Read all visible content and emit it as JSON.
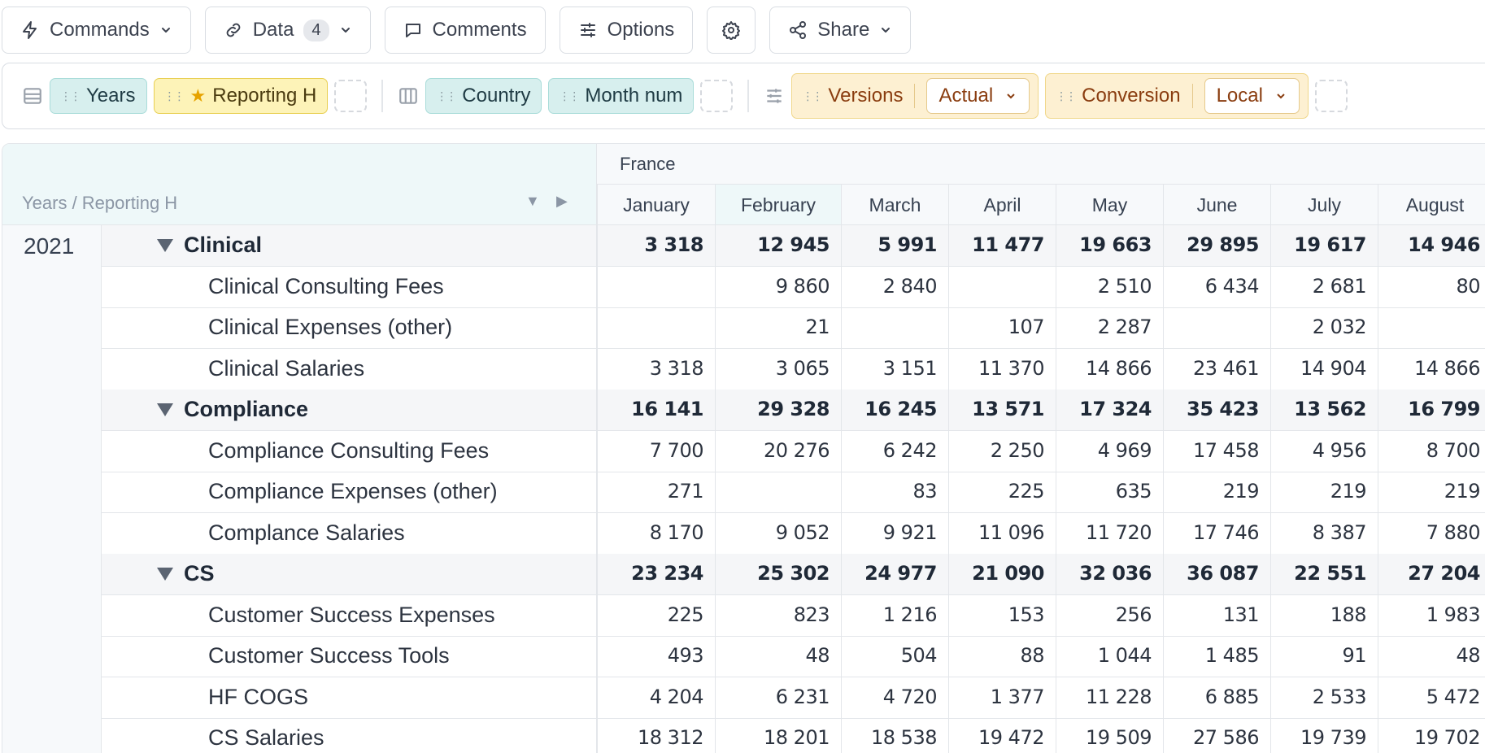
{
  "toolbar": {
    "commands": "Commands",
    "data": "Data",
    "data_count": "4",
    "comments": "Comments",
    "options": "Options",
    "share": "Share"
  },
  "pivot": {
    "rows": [
      "Years",
      "Reporting H"
    ],
    "columns": [
      "Country",
      "Month num"
    ],
    "filters": [
      {
        "name": "Versions",
        "value": "Actual"
      },
      {
        "name": "Conversion",
        "value": "Local"
      }
    ]
  },
  "grid": {
    "corner_label": "Years / Reporting H",
    "country": "France",
    "months": [
      "January",
      "February",
      "March",
      "April",
      "May",
      "June",
      "July",
      "August"
    ],
    "year": "2021",
    "rows": [
      {
        "type": "group",
        "label": "Clinical",
        "values": [
          "3 318",
          "12 945",
          "5 991",
          "11 477",
          "19 663",
          "29 895",
          "19 617",
          "14 946"
        ]
      },
      {
        "type": "leaf",
        "label": "Clinical Consulting Fees",
        "values": [
          "",
          "9 860",
          "2 840",
          "",
          "2 510",
          "6 434",
          "2 681",
          "80"
        ]
      },
      {
        "type": "leaf",
        "label": "Clinical Expenses (other)",
        "values": [
          "",
          "21",
          "",
          "107",
          "2 287",
          "",
          "2 032",
          ""
        ]
      },
      {
        "type": "leaf",
        "label": "Clinical Salaries",
        "values": [
          "3 318",
          "3 065",
          "3 151",
          "11 370",
          "14 866",
          "23 461",
          "14 904",
          "14 866"
        ]
      },
      {
        "type": "group",
        "label": "Compliance",
        "values": [
          "16 141",
          "29 328",
          "16 245",
          "13 571",
          "17 324",
          "35 423",
          "13 562",
          "16 799"
        ]
      },
      {
        "type": "leaf",
        "label": "Compliance Consulting Fees",
        "values": [
          "7 700",
          "20 276",
          "6 242",
          "2 250",
          "4 969",
          "17 458",
          "4 956",
          "8 700"
        ]
      },
      {
        "type": "leaf",
        "label": "Compliance Expenses (other)",
        "values": [
          "271",
          "",
          "83",
          "225",
          "635",
          "219",
          "219",
          "219"
        ]
      },
      {
        "type": "leaf",
        "label": "Complance Salaries",
        "values": [
          "8 170",
          "9 052",
          "9 921",
          "11 096",
          "11 720",
          "17 746",
          "8 387",
          "7 880"
        ]
      },
      {
        "type": "group",
        "label": "CS",
        "values": [
          "23 234",
          "25 302",
          "24 977",
          "21 090",
          "32 036",
          "36 087",
          "22 551",
          "27 204"
        ]
      },
      {
        "type": "leaf",
        "label": "Customer Success Expenses",
        "values": [
          "225",
          "823",
          "1 216",
          "153",
          "256",
          "131",
          "188",
          "1 983"
        ]
      },
      {
        "type": "leaf",
        "label": "Customer Success Tools",
        "values": [
          "493",
          "48",
          "504",
          "88",
          "1 044",
          "1 485",
          "91",
          "48"
        ]
      },
      {
        "type": "leaf",
        "label": "HF COGS",
        "values": [
          "4 204",
          "6 231",
          "4 720",
          "1 377",
          "11 228",
          "6 885",
          "2 533",
          "5 472"
        ]
      },
      {
        "type": "leaf",
        "label": "CS Salaries",
        "values": [
          "18 312",
          "18 201",
          "18 538",
          "19 472",
          "19 509",
          "27 586",
          "19 739",
          "19 702"
        ]
      }
    ]
  }
}
